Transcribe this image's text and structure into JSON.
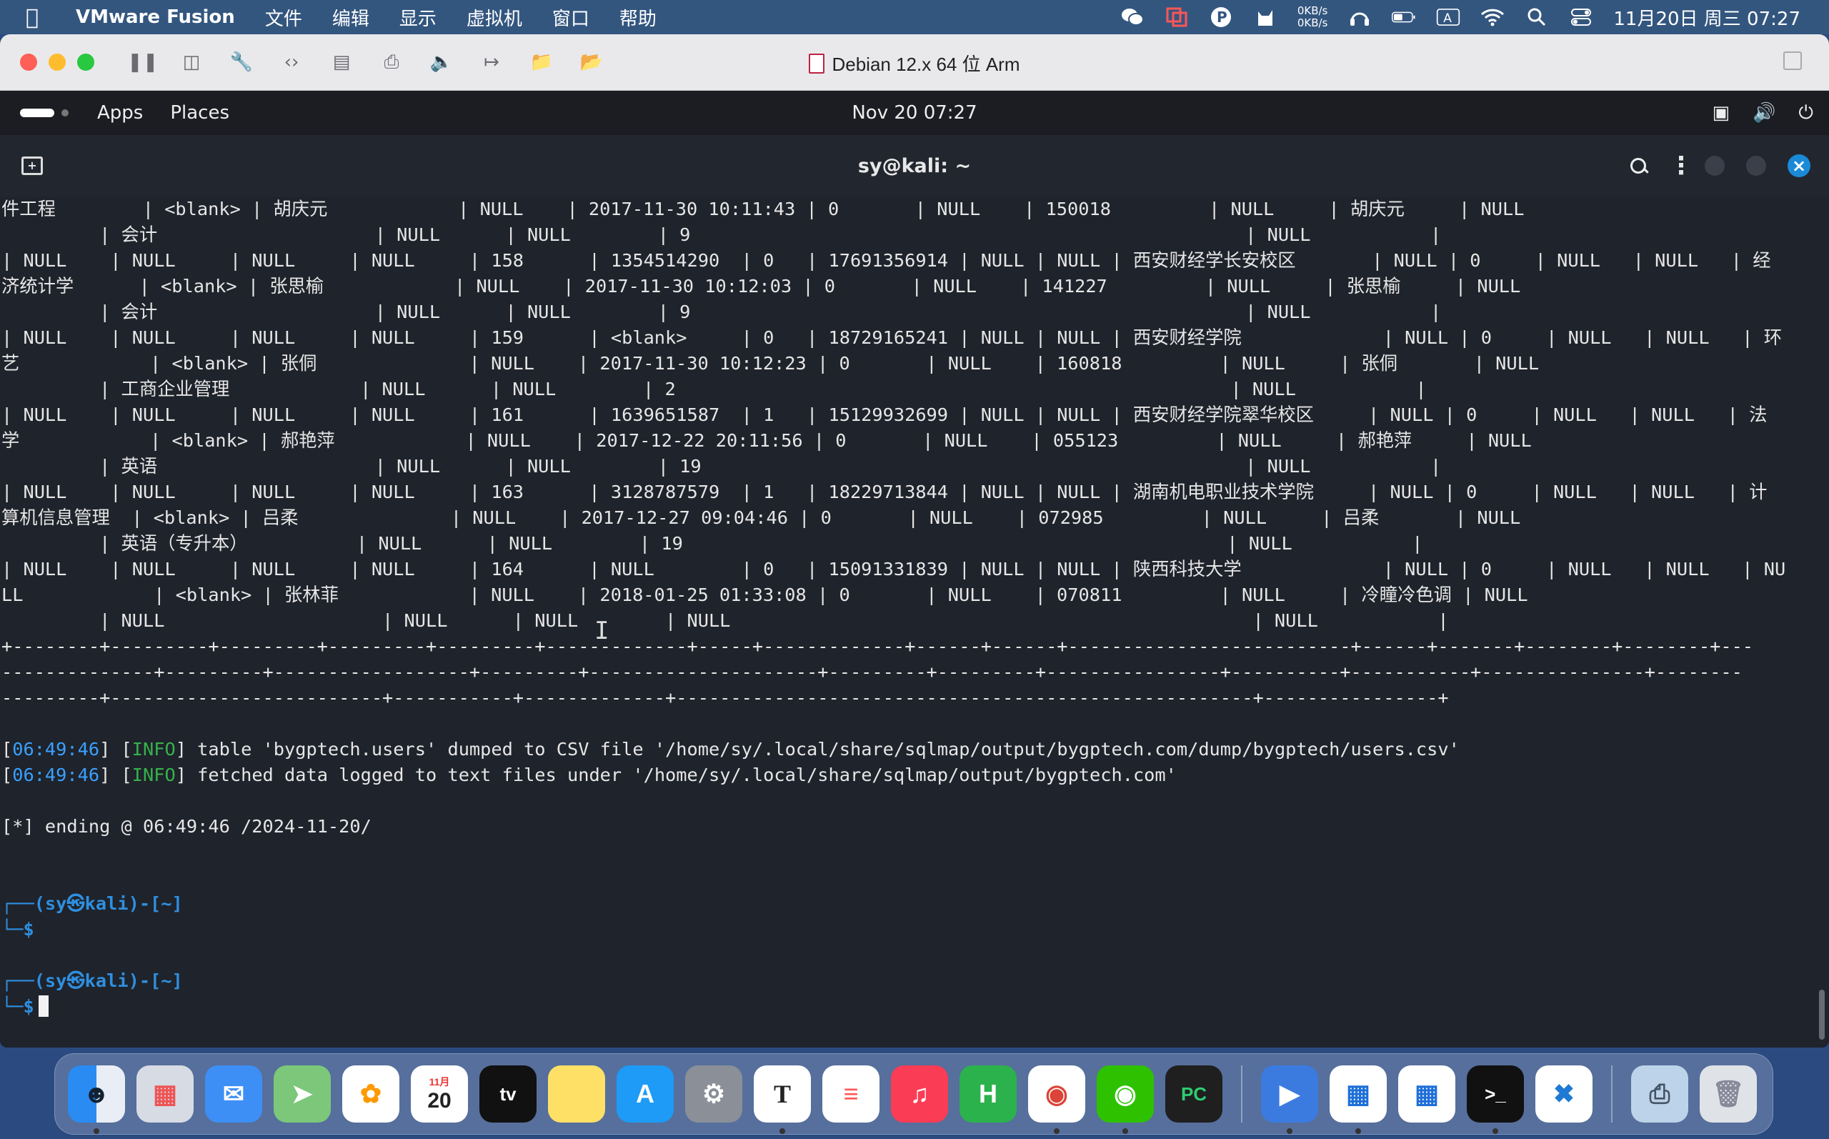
{
  "menubar": {
    "app_name": "VMware Fusion",
    "menus": [
      "文件",
      "编辑",
      "显示",
      "虚拟机",
      "窗口",
      "帮助"
    ],
    "net_up": "0KB/s",
    "net_down": "0KB/s",
    "input_method": "A",
    "clock": "11月20日 周三 07:27"
  },
  "vm": {
    "title": "Debian 12.x 64 位 Arm"
  },
  "gnome": {
    "apps_label": "Apps",
    "places_label": "Places",
    "datetime": "Nov 20  07:27"
  },
  "terminal": {
    "title": "sy@kali: ~",
    "table_lines": [
      "件工程        | <blank> | 胡庆元            | NULL    | 2017-11-30 10:11:43 | 0       | NULL    | 150018         | NULL     | 胡庆元     | NULL",
      "         | 会计                    | NULL      | NULL        | 9                                                   | NULL           |",
      "| NULL    | NULL     | NULL     | NULL     | 158      | 1354514290  | 0   | 17691356914 | NULL | NULL | 西安财经学长安校区       | NULL | 0     | NULL   | NULL   | 经",
      "济统计学      | <blank> | 张思榆            | NULL    | 2017-11-30 10:12:03 | 0       | NULL    | 141227         | NULL     | 张思榆     | NULL",
      "         | 会计                    | NULL      | NULL        | 9                                                   | NULL           |",
      "| NULL    | NULL     | NULL     | NULL     | 159      | <blank>     | 0   | 18729165241 | NULL | NULL | 西安财经学院             | NULL | 0     | NULL   | NULL   | 环",
      "艺            | <blank> | 张侗              | NULL    | 2017-11-30 10:12:23 | 0       | NULL    | 160818         | NULL     | 张侗       | NULL",
      "         | 工商企业管理            | NULL      | NULL        | 2                                                   | NULL           |",
      "| NULL    | NULL     | NULL     | NULL     | 161      | 1639651587  | 1   | 15129932699 | NULL | NULL | 西安财经学院翠华校区     | NULL | 0     | NULL   | NULL   | 法",
      "学            | <blank> | 郝艳萍            | NULL    | 2017-12-22 20:11:56 | 0       | NULL    | 055123         | NULL     | 郝艳萍     | NULL",
      "         | 英语                    | NULL      | NULL        | 19                                                  | NULL           |",
      "| NULL    | NULL     | NULL     | NULL     | 163      | 3128787579  | 1   | 18229713844 | NULL | NULL | 湖南机电职业技术学院     | NULL | 0     | NULL   | NULL   | 计",
      "算机信息管理  | <blank> | 吕柔              | NULL    | 2017-12-27 09:04:46 | 0       | NULL    | 072985         | NULL     | 吕柔       | NULL",
      "         | 英语（专升本）          | NULL      | NULL        | 19                                                  | NULL           |",
      "| NULL    | NULL     | NULL     | NULL     | 164      | NULL        | 0   | 15091331839 | NULL | NULL | 陕西科技大学             | NULL | 0     | NULL   | NULL   | NU",
      "LL            | <blank> | 张林菲            | NULL    | 2018-01-25 01:33:08 | 0       | NULL    | 070811         | NULL     | 冷瞳冷色调 | NULL",
      "         | NULL                    | NULL      | NULL        | NULL                                                | NULL           |",
      "+--------+---------+---------+---------+---------+-------------+-----+-------------+------+------+--------------------------+------+-------+--------+--------+---",
      "--------------+---------+------------------+---------+---------------------+---------+---------+----------------+----------+-----------+---------------+--------",
      "---------+-------------------------+-----------+-------------+-----------------------------------------------------+----------------+"
    ],
    "log": [
      {
        "ts": "06:49:46",
        "level": "INFO",
        "msg": " table 'bygptech.users' dumped to CSV file '/home/sy/.local/share/sqlmap/output/bygptech.com/dump/bygptech/users.csv'"
      },
      {
        "ts": "06:49:46",
        "level": "INFO",
        "msg": " fetched data logged to text files under '/home/sy/.local/share/sqlmap/output/bygptech.com'"
      }
    ],
    "ending": "[*] ending @ 06:49:46 /2024-11-20/",
    "prompt_top": "┌──(sy㉿kali)-[~]",
    "prompt_bottom": "└─$"
  },
  "dock": {
    "calendar_month": "11月",
    "calendar_day": "20",
    "items": [
      "finder",
      "launchpad",
      "mail",
      "maps",
      "photos",
      "calendar",
      "apple-tv",
      "notes",
      "app-store",
      "system-settings",
      "typora",
      "reminders",
      "music",
      "hbuilder",
      "chrome",
      "wechat",
      "pycharm",
      "media-player",
      "vmware-fusion",
      "vmware-fusion-2",
      "terminal",
      "vscode",
      "downloads",
      "trash"
    ]
  }
}
